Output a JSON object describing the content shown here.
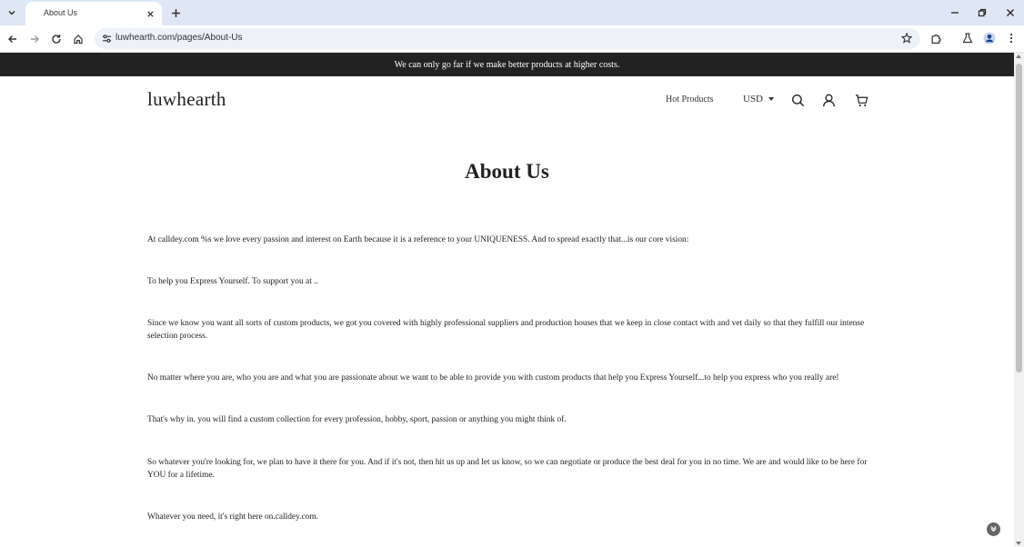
{
  "browser": {
    "tab_title": "About Us",
    "url": "luwhearth.com/pages/About-Us"
  },
  "announcement": "We can only go far if we make better products at higher costs.",
  "header": {
    "logo": "luwhearth",
    "nav_hot_products": "Hot Products",
    "currency": "USD"
  },
  "main": {
    "title": "About Us",
    "paragraphs": [
      "At calldey.com %s we love every passion and interest on Earth because it is a reference to your UNIQUENESS. And to spread exactly that...is our core vision:",
      "To help you Express Yourself. To support you at ..",
      "Since we know you want all sorts of custom products, we got you covered with highly professional suppliers and production houses that we keep in close contact with and vet daily so that they fulfill our intense selection process.",
      "No matter where you are, who you are and what you are passionate about we want to be able to provide you with custom products that help you Express Yourself...to help you express who you really are!",
      "That's why in. you will find a custom collection for every profession, hobby, sport, passion or anything you might think of.",
      "So whatever you're looking for, we plan to have it there for you. And if it's not, then hit us up and let us know, so we can negotiate or produce the best deal for you in no time. We are and would like to be here for YOU for a lifetime.",
      "Whatever you need, it's right here on.calldey.com."
    ]
  },
  "icons": {
    "tab_dropdown": "chevron-down-icon",
    "close": "close-icon",
    "new_tab": "plus-icon",
    "back": "back-arrow-icon",
    "forward": "forward-arrow-icon",
    "reload": "reload-icon",
    "home": "home-icon",
    "site_info": "tune-icon",
    "bookmark": "star-icon",
    "extensions": "puzzle-icon",
    "labs": "flask-icon",
    "profile": "profile-icon",
    "menu": "kebab-menu-icon",
    "search": "search-icon",
    "account": "user-icon",
    "cart": "cart-icon"
  }
}
